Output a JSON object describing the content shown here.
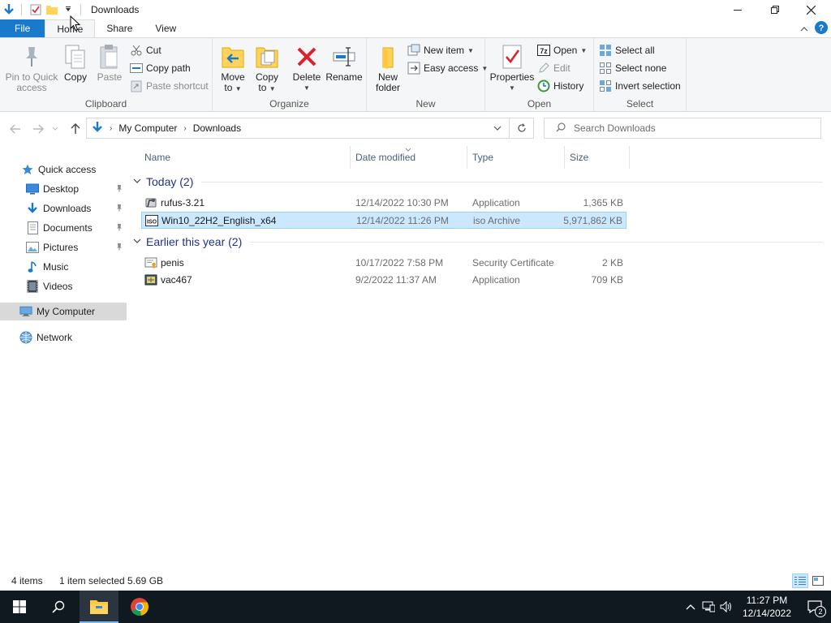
{
  "window": {
    "title": "Downloads"
  },
  "ribbon_tabs": [
    {
      "label": "File"
    },
    {
      "label": "Home"
    },
    {
      "label": "Share"
    },
    {
      "label": "View"
    }
  ],
  "ribbon": {
    "clipboard": {
      "label": "Clipboard",
      "pin_label_1": "Pin to Quick",
      "pin_label_2": "access",
      "copy": "Copy",
      "paste": "Paste",
      "cut": "Cut",
      "copy_path": "Copy path",
      "paste_shortcut": "Paste shortcut"
    },
    "organize": {
      "label": "Organize",
      "move_to_1": "Move",
      "move_to_2": "to",
      "copy_to_1": "Copy",
      "copy_to_2": "to",
      "delete": "Delete",
      "rename": "Rename"
    },
    "new": {
      "label": "New",
      "new_folder_1": "New",
      "new_folder_2": "folder",
      "new_item": "New item",
      "easy_access": "Easy access"
    },
    "open": {
      "label": "Open",
      "properties": "Properties",
      "open": "Open",
      "edit": "Edit",
      "history": "History"
    },
    "select": {
      "label": "Select",
      "select_all": "Select all",
      "select_none": "Select none",
      "invert_selection": "Invert selection"
    }
  },
  "address": {
    "crumbs": [
      "My Computer",
      "Downloads"
    ],
    "search_placeholder": "Search Downloads"
  },
  "navpane": {
    "items": [
      {
        "label": "Quick access",
        "icon": "star-icon"
      },
      {
        "label": "Desktop",
        "icon": "desktop-icon"
      },
      {
        "label": "Downloads",
        "icon": "download-icon"
      },
      {
        "label": "Documents",
        "icon": "document-icon"
      },
      {
        "label": "Pictures",
        "icon": "pictures-icon"
      },
      {
        "label": "Music",
        "icon": "music-icon"
      },
      {
        "label": "Videos",
        "icon": "video-icon"
      },
      {
        "label": "My Computer",
        "icon": "computer-icon"
      },
      {
        "label": "Network",
        "icon": "network-icon"
      }
    ]
  },
  "columns": {
    "name": "Name",
    "date": "Date modified",
    "type": "Type",
    "size": "Size"
  },
  "groups": [
    {
      "label": "Today (2)",
      "files": [
        {
          "name": "rufus-3.21",
          "date": "12/14/2022 10:30 PM",
          "type": "Application",
          "size": "1,365 KB",
          "icon": "app-icon"
        },
        {
          "name": "Win10_22H2_English_x64",
          "date": "12/14/2022 11:26 PM",
          "type": "iso Archive",
          "size": "5,971,862 KB",
          "icon": "iso-icon"
        }
      ]
    },
    {
      "label": "Earlier this year (2)",
      "files": [
        {
          "name": "penis",
          "date": "10/17/2022 7:58 PM",
          "type": "Security Certificate",
          "size": "2 KB",
          "icon": "certificate-icon"
        },
        {
          "name": "vac467",
          "date": "9/2/2022 11:37 AM",
          "type": "Application",
          "size": "709 KB",
          "icon": "app-icon"
        }
      ]
    }
  ],
  "status": {
    "items": "4 items",
    "selected": "1 item selected",
    "size": "5.69 GB"
  },
  "taskbar": {
    "time": "11:27 PM",
    "date": "12/14/2022",
    "notifications": "2"
  },
  "colors": {
    "accent": "#1979ca",
    "selection": "#cce8ff",
    "group_header": "#1e3287",
    "taskbar": "#101820"
  }
}
